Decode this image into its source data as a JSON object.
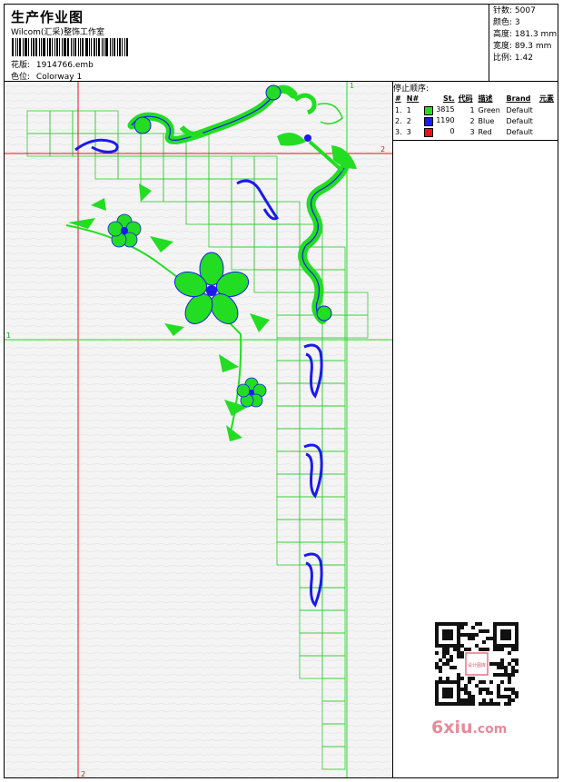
{
  "header": {
    "title": "生产作业图",
    "subtitle": "Wilcom(汇采)整饰工作室",
    "design_label": "花版:",
    "design_file": "1914766.emb",
    "colorway_label": "色位:",
    "colorway": "Colorway 1"
  },
  "stats": [
    {
      "label": "针数:",
      "value": "5007"
    },
    {
      "label": "颜色:",
      "value": "3"
    },
    {
      "label": "高度:",
      "value": "181.3 mm"
    },
    {
      "label": "宽度:",
      "value": "89.3 mm"
    },
    {
      "label": "比例:",
      "value": "1.42"
    }
  ],
  "stop_sequence": {
    "heading": "停止顺序:",
    "columns": [
      "#",
      "N#",
      "St.",
      "代码",
      "描述",
      "Brand",
      "元素"
    ],
    "rows": [
      {
        "idx": "1.",
        "n": "1",
        "color": "#22dd22",
        "stitches": "3815",
        "code": "1",
        "desc": "Green",
        "brand": "Default"
      },
      {
        "idx": "2.",
        "n": "2",
        "color": "#1a1aee",
        "stitches": "1190",
        "code": "2",
        "desc": "Blue",
        "brand": "Default"
      },
      {
        "idx": "3.",
        "n": "3",
        "color": "#ee1111",
        "stitches": "0",
        "code": "3",
        "desc": "Red",
        "brand": "Default"
      }
    ]
  },
  "guides": {
    "v1_label": "1",
    "h2_label": "2",
    "h1_label": "1",
    "v2_label": "2"
  },
  "watermark": {
    "text": "6xiu",
    "suffix": ".com",
    "stamp": "设计图库"
  },
  "colors": {
    "green": "#22dd22",
    "blue": "#1a1aee",
    "red": "#ee1111",
    "grid": "#33cc33"
  }
}
